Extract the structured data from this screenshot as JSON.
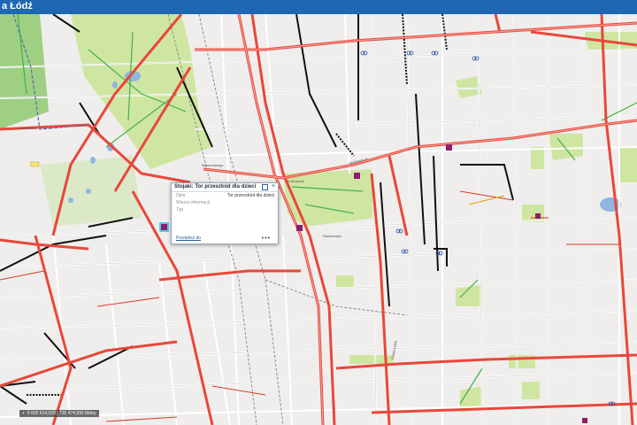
{
  "app": {
    "title": "a Łódź"
  },
  "popup": {
    "title": "Stojaki: Tor przeszkód dla dzieci",
    "rows": [
      {
        "label": "Opis",
        "value": "Tor przeszkód dla dzieci"
      },
      {
        "label": "Więcej informacji",
        "value": ""
      },
      {
        "label": "Typ",
        "value": ""
      }
    ],
    "zoom_label": "Powiększ do",
    "more_label": "•••",
    "close_symbol": "×"
  },
  "coords": {
    "plus": "+",
    "text": "6 602 614,029 | 735 474,992 Metry"
  },
  "streets": {
    "s1": "Mickiewicza",
    "s2": "Kościuszki",
    "s3": "Bandurskiego",
    "s4": "Radwańska",
    "s5": "Piotrkowska",
    "s6": "Karolewska"
  },
  "colors": {
    "topbar": "#1f66b3",
    "main_road": "#e9473a",
    "bike_path": "#d93a2e",
    "park": "#cfe6a2",
    "water": "#8fb6e0",
    "tram": "#111111"
  }
}
